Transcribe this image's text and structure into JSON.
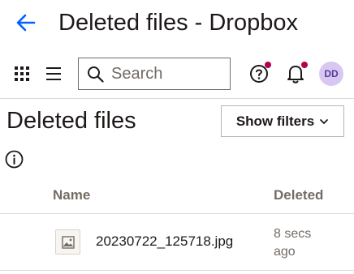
{
  "window": {
    "title": "Deleted files - Dropbox"
  },
  "toolbar": {
    "search_placeholder": "Search",
    "avatar_initials": "DD",
    "notification_color": "#b4004f"
  },
  "page": {
    "title": "Deleted files",
    "filter_button_label": "Show filters"
  },
  "table": {
    "columns": [
      "Name",
      "Deleted"
    ],
    "rows": [
      {
        "name": "20230722_125718.jpg",
        "deleted": "8 secs ago",
        "icon": "image-file-icon"
      }
    ]
  },
  "colors": {
    "accent": "#0061fe",
    "avatar_bg": "#d8c8f1",
    "avatar_text": "#5b3a9e",
    "muted_text": "#736c64"
  }
}
